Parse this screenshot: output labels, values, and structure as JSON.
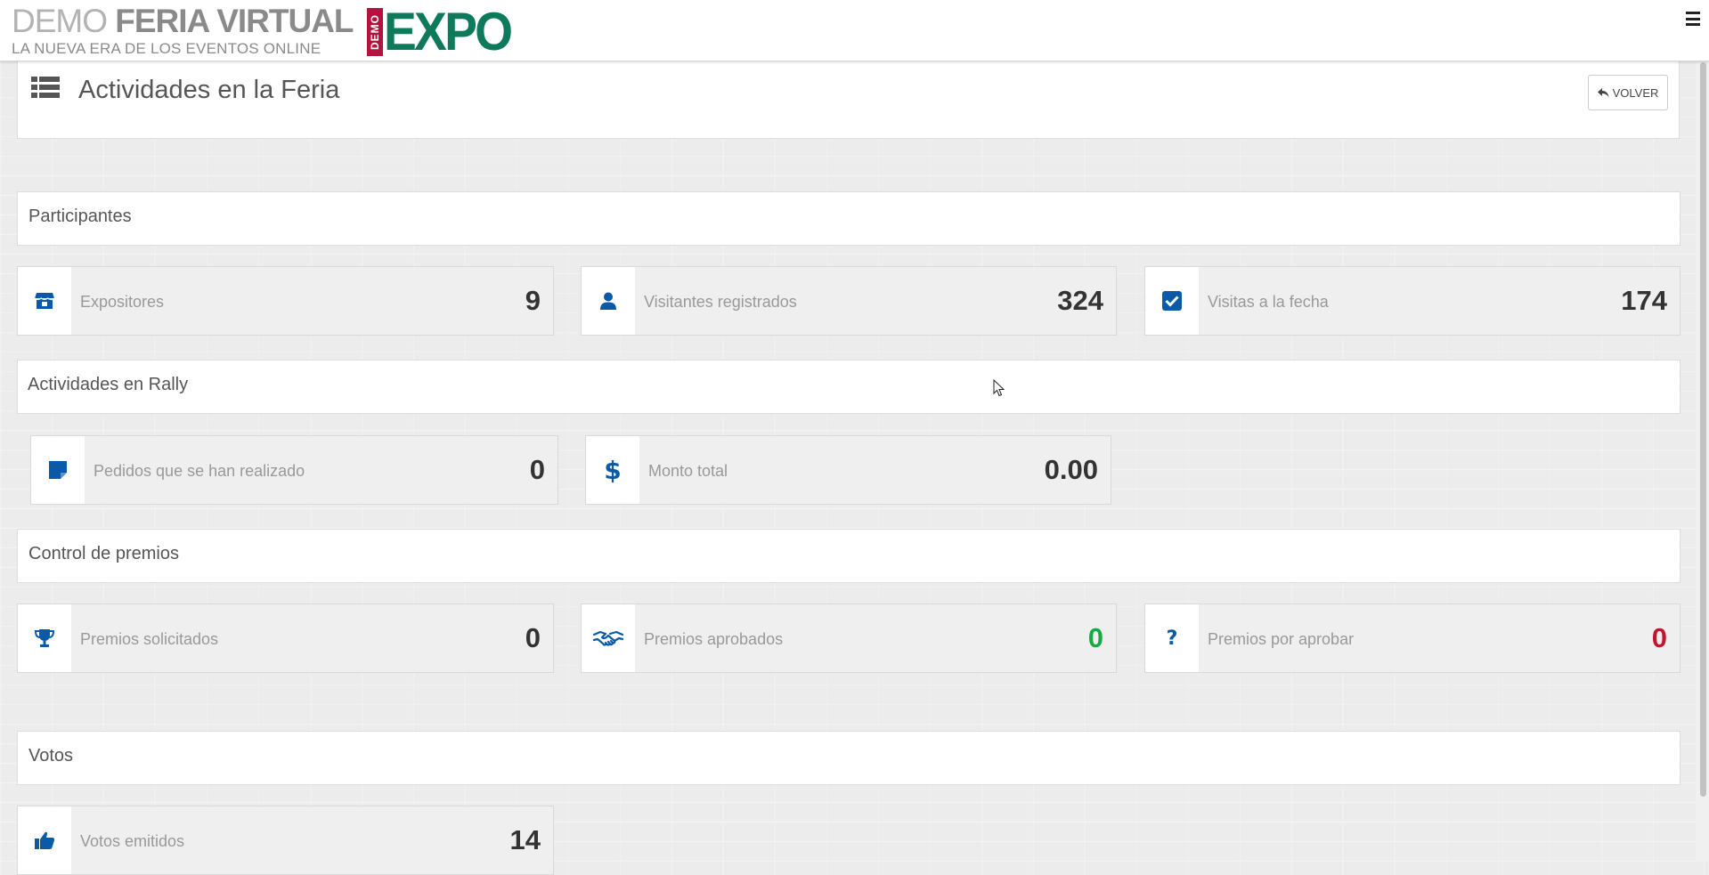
{
  "header": {
    "brand_demo": "DEMO",
    "brand_name": "FERIA VIRTUAL",
    "tagline": "LA NUEVA ERA DE LOS EVENTOS ONLINE",
    "logo_demo": "DEMO",
    "logo_word": "EXPO",
    "menu_icon": "hamburger-menu-icon"
  },
  "page": {
    "title": "Actividades en la Feria",
    "title_icon": "list-icon",
    "back_label": "VOLVER",
    "back_icon": "reply-arrow-icon"
  },
  "sections": {
    "participantes": {
      "title": "Participantes",
      "stats": [
        {
          "label": "Expositores",
          "value": "9",
          "icon": "store-icon"
        },
        {
          "label": "Visitantes registrados",
          "value": "324",
          "icon": "user-icon"
        },
        {
          "label": "Visitas a la fecha",
          "value": "174",
          "icon": "checkbox-icon"
        }
      ]
    },
    "rally": {
      "title": "Actividades en Rally",
      "stats": [
        {
          "label": "Pedidos que se han realizado",
          "value": "0",
          "icon": "sticky-note-icon"
        },
        {
          "label": "Monto total",
          "value": "0.00",
          "icon": "dollar-icon"
        }
      ]
    },
    "premios": {
      "title": "Control de premios",
      "stats": [
        {
          "label": "Premios solicitados",
          "value": "0",
          "icon": "trophy-icon"
        },
        {
          "label": "Premios aprobados",
          "value": "0",
          "icon": "handshake-icon"
        },
        {
          "label": "Premios por aprobar",
          "value": "0",
          "icon": "question-icon"
        }
      ]
    },
    "votos": {
      "title": "Votos",
      "stats": [
        {
          "label": "Votos emitidos",
          "value": "14",
          "icon": "thumbs-up-icon"
        }
      ]
    }
  },
  "colors": {
    "icon_blue": "#0b5aa8",
    "approved_green": "#18a944",
    "pending_red": "#c01530",
    "logo_green": "#0e7a5c",
    "logo_red": "#b5123e"
  }
}
